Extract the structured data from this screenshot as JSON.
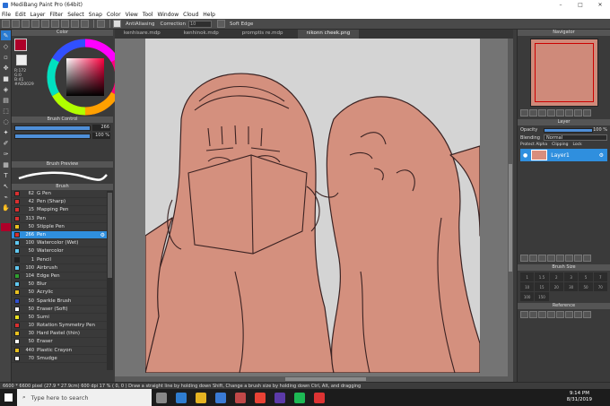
{
  "title": "MediBang Paint Pro (64bit)",
  "menu": [
    "File",
    "Edit",
    "Layer",
    "Filter",
    "Select",
    "Snap",
    "Color",
    "View",
    "Tool",
    "Window",
    "Cloud",
    "Help"
  ],
  "toolbar": {
    "antialias": "AntiAliasing",
    "correction": "Correction",
    "correction_val": "10",
    "soft_edge": "Soft Edge"
  },
  "tabs": [
    "kenhisare.mdp",
    "kenhinok.mdp",
    "promptis re.mdp",
    "nikonn cheek.png"
  ],
  "color_panel": {
    "title": "Color",
    "r": "R:172",
    "g": "G:0",
    "b": "B:41",
    "hex": "#AD0029"
  },
  "brush_control": {
    "title": "Brush Control",
    "size": "266",
    "opacity": "100 %"
  },
  "brush_preview": {
    "title": "Brush Preview"
  },
  "brush": {
    "title": "Brush",
    "items": [
      {
        "size": "62",
        "name": "G Pen",
        "color": "#d83030"
      },
      {
        "size": "42",
        "name": "Pen (Sharp)",
        "color": "#d83030"
      },
      {
        "size": "15",
        "name": "Mapping Pen",
        "color": "#d83030"
      },
      {
        "size": "313",
        "name": "Pen",
        "color": "#d83030"
      },
      {
        "size": "50",
        "name": "Stipple Pen",
        "color": "#e8c020"
      },
      {
        "size": "266",
        "name": "Pen",
        "color": "#d83030"
      },
      {
        "size": "100",
        "name": "Watercolor (Wet)",
        "color": "#60c8f0"
      },
      {
        "size": "50",
        "name": "Watercolor",
        "color": "#60c8f0"
      },
      {
        "size": "1",
        "name": "Pencil",
        "color": "#222222"
      },
      {
        "size": "100",
        "name": "Airbrush",
        "color": "#60c8f0"
      },
      {
        "size": "104",
        "name": "Edge Pen",
        "color": "#30a030"
      },
      {
        "size": "50",
        "name": "Blur",
        "color": "#60c8f0"
      },
      {
        "size": "50",
        "name": "Acrylic",
        "color": "#e8c020"
      },
      {
        "size": "50",
        "name": "Sparkle Brush",
        "color": "#3050d0"
      },
      {
        "size": "50",
        "name": "Eraser (Soft)",
        "color": "#ffffff"
      },
      {
        "size": "50",
        "name": "Sumi",
        "color": "#e8e020"
      },
      {
        "size": "10",
        "name": "Rotation Symmetry Pen",
        "color": "#d83030"
      },
      {
        "size": "30",
        "name": "Hard Pastel (thin)",
        "color": "#e8c020"
      },
      {
        "size": "50",
        "name": "Eraser",
        "color": "#ffffff"
      },
      {
        "size": "440",
        "name": "Plastic Crayon",
        "color": "#e8c020"
      },
      {
        "size": "70",
        "name": "Smudge",
        "color": "#ffffff"
      }
    ]
  },
  "navigator": {
    "title": "Navigator"
  },
  "layer": {
    "title": "Layer",
    "opacity_label": "Opacity",
    "opacity": "100 %",
    "blending_label": "Blending",
    "blending": "Normal",
    "protect": "Protect Alpha",
    "clipping": "Clipping",
    "lock": "Lock",
    "layer_name": "Layer1"
  },
  "brush_size": {
    "title": "Brush Size",
    "values": [
      "1",
      "1.5",
      "2",
      "3",
      "5",
      "7",
      "10",
      "15",
      "20",
      "30",
      "50",
      "70",
      "100",
      "150"
    ]
  },
  "reference": {
    "title": "Reference"
  },
  "status": "6600 * 6600 pixel  (27.9 * 27.9cm)  600 dpi  17 %  ( 0, 0 )  Draw a straight line by holding down Shift, Change a brush size by holding down Ctrl, Alt, and dragging",
  "taskbar": {
    "search": "Type here to search",
    "time": "9:14 PM",
    "date": "8/31/2019"
  },
  "colors": {
    "fg": "#AD0029",
    "accent": "#2f8fde",
    "skin": "#d4907e"
  }
}
